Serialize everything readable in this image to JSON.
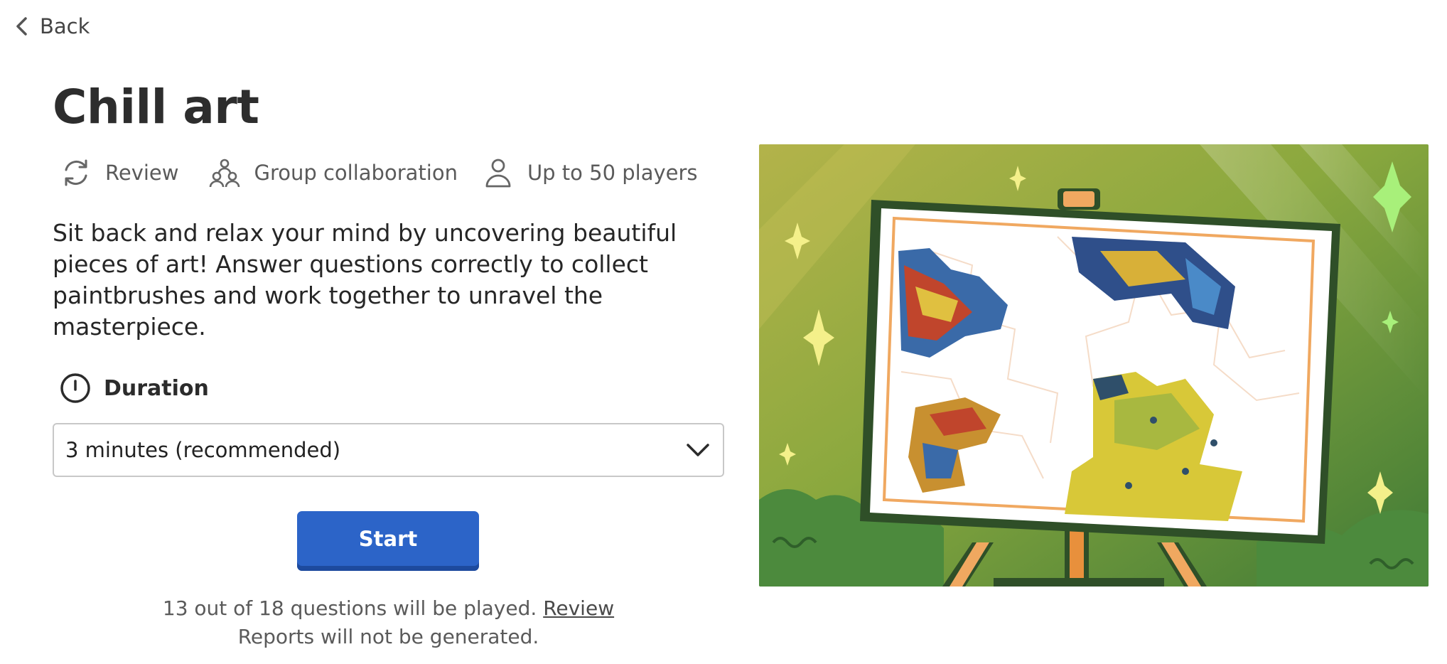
{
  "nav": {
    "back_label": "Back",
    "back_icon": "chevron-left-icon"
  },
  "activity": {
    "title": "Chill art",
    "meta": [
      {
        "icon": "refresh-icon",
        "label": "Review"
      },
      {
        "icon": "group-icon",
        "label": "Group collaboration"
      },
      {
        "icon": "person-icon",
        "label": "Up to 50 players"
      }
    ],
    "description": "Sit back and relax your mind by uncovering beautiful pieces of art! Answer questions correctly to collect paintbrushes and work together to unravel the masterpiece."
  },
  "duration": {
    "label": "Duration",
    "icon": "clock-icon",
    "selected": "3 minutes (recommended)",
    "dropdown_icon": "chevron-down-icon"
  },
  "start_button": {
    "label": "Start",
    "color": "#2c64c8"
  },
  "footer": {
    "questions_text": "13 out of 18 questions will be played.",
    "review_link": "Review",
    "reports_text": "Reports will not be generated."
  },
  "hero": {
    "image": "easel-puzzle-painting-illustration"
  }
}
